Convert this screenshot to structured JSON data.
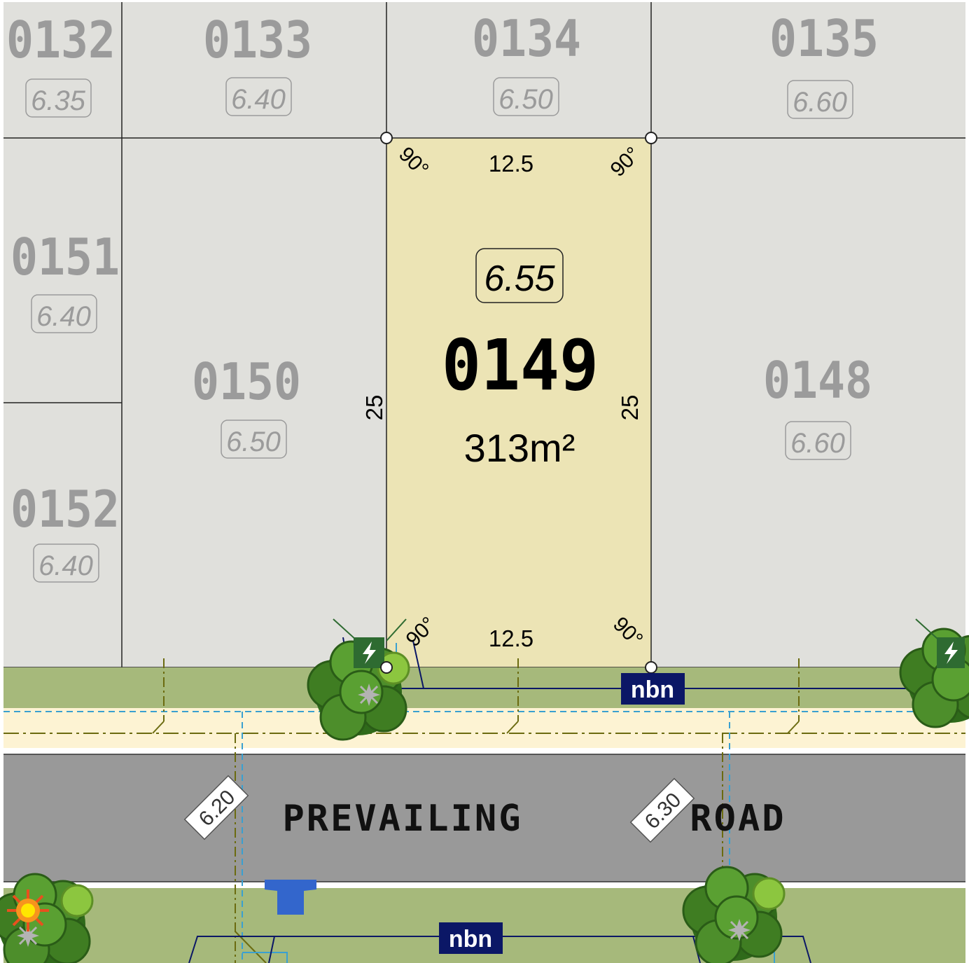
{
  "subject_lot": {
    "number": "0149",
    "area": "313m²",
    "level": "6.55",
    "dim_top": "12.5",
    "dim_bottom": "12.5",
    "dim_left": "25",
    "dim_right": "25",
    "angle": "90°",
    "fill_color": "#ece4b5"
  },
  "neighbour_lots": [
    {
      "number": "0132",
      "level": "6.35"
    },
    {
      "number": "0133",
      "level": "6.40"
    },
    {
      "number": "0134",
      "level": "6.50"
    },
    {
      "number": "0135",
      "level": "6.60"
    },
    {
      "number": "0151",
      "level": "6.40"
    },
    {
      "number": "0150",
      "level": "6.50"
    },
    {
      "number": "0148",
      "level": "6.60"
    },
    {
      "number": "0152",
      "level": "6.40"
    }
  ],
  "road": {
    "name_part1": "PREVAILING",
    "name_part2": "ROAD",
    "level_left": "6.20",
    "level_right": "6.30"
  },
  "nbn": {
    "label_top": "nbn",
    "label_bottom": "nbn",
    "color": "#0b1766"
  },
  "colors": {
    "neighbour_lot": "#e0e0dc",
    "verge": "#a6b97b",
    "footpath": "#fdf3d3",
    "road": "#999999",
    "tree_dark": "#3f7d22",
    "tree_light": "#8cc63f",
    "power_pit": "#2e6b31",
    "water_meter": "#3366cc"
  },
  "icons": [
    "tree-icon",
    "power-pit-icon",
    "street-light-icon",
    "water-meter-icon",
    "survey-peg-icon"
  ]
}
